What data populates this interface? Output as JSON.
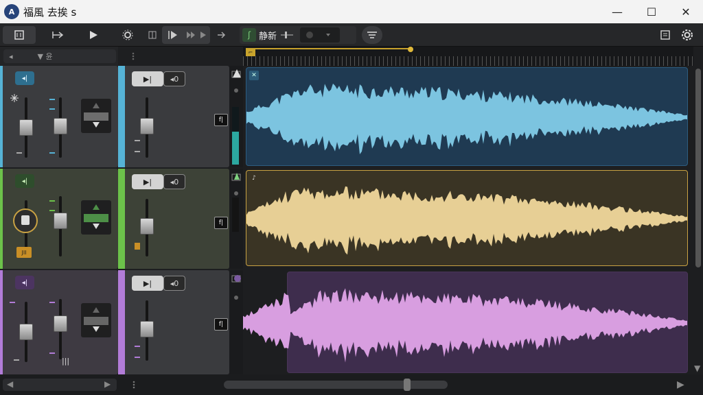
{
  "window": {
    "title": "福風 去挨 s",
    "app_icon_label": "A",
    "minimize": "—",
    "maximize": "☐",
    "close": "✕"
  },
  "toolbar": {
    "preset_label": "静新",
    "preset_icon": "ʃ",
    "icons": [
      "mixer-icon",
      "route-icon",
      "play-icon",
      "settings-gear-icon",
      "loop-icon",
      "play-from-start-icon",
      "fast-forward-icon",
      "skip-icon",
      "eq-icon",
      "doc-icon",
      "gear-icon"
    ]
  },
  "left_header": {
    "left_arrow": "◂",
    "filter": "▼ 윤"
  },
  "tracks": [
    {
      "id": "blue",
      "color": "#56b3d6",
      "clip_fill": "#1f3a52",
      "wave_color": "#7cc4e0",
      "clip_border": "#2d5d80",
      "pan_icon": "◂|"
    },
    {
      "id": "green",
      "color": "#6cc24a",
      "clip_fill": "#3a3424",
      "wave_color": "#e7cf95",
      "clip_border": "#c9a243",
      "pan_icon": "◂|"
    },
    {
      "id": "purple",
      "color": "#b27cd8",
      "clip_fill": "#3e2d4d",
      "wave_color": "#d89ee0",
      "clip_border": "#4a3559",
      "pan_icon": "◂|"
    }
  ],
  "insert": {
    "play_label": "▶|",
    "monitor_label": "◂0",
    "fx_label": "f|"
  },
  "misc": {
    "meter_label": "JII",
    "bars_label": "|||"
  }
}
